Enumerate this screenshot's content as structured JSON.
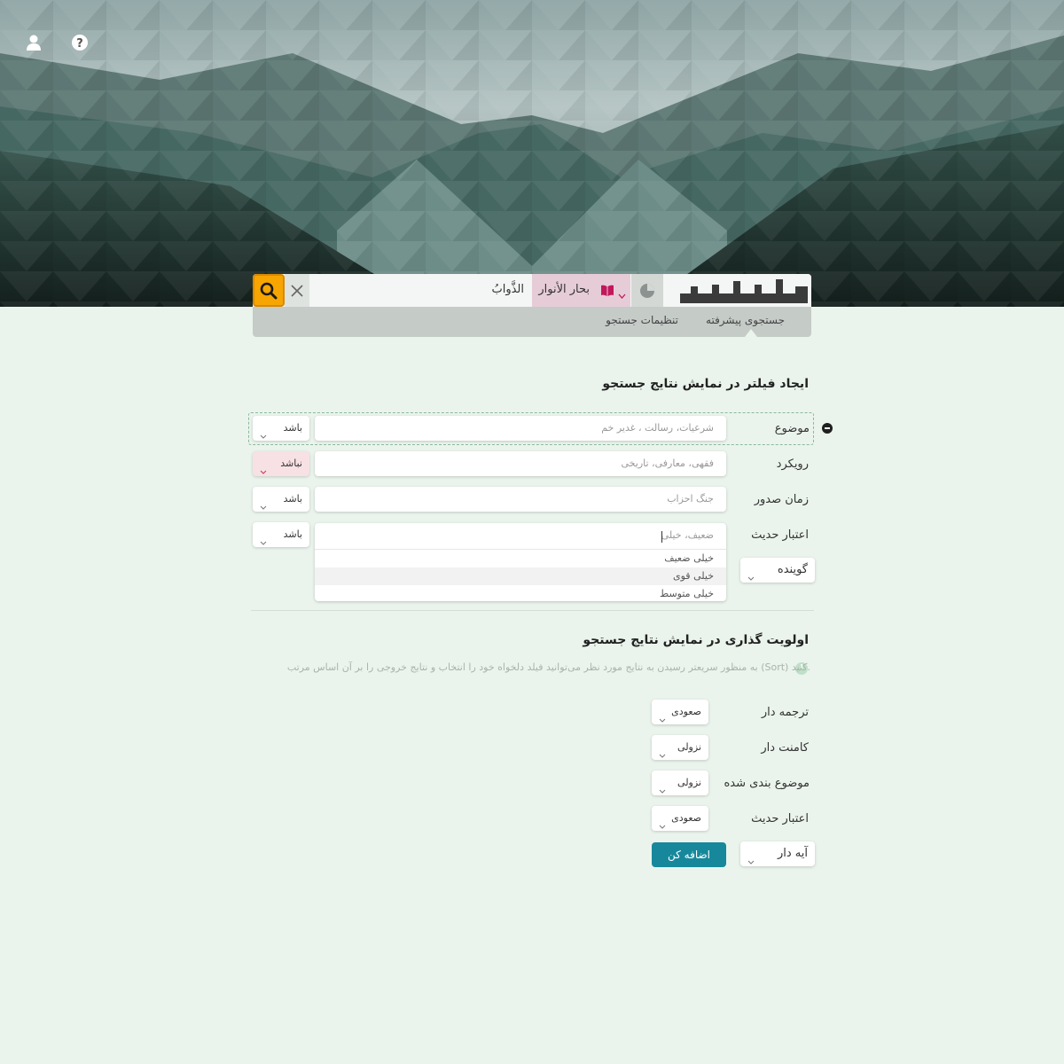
{
  "header": {
    "user_icon": "user-icon",
    "help_icon": "question-circle-icon"
  },
  "search": {
    "query": "الذَّوابُ",
    "book": "بحار الأنوار",
    "tabs": [
      "جستجوی پیشرفته",
      "تنظیمات جستجو"
    ],
    "accent_color": "#f7a500"
  },
  "filter_section": {
    "title": "ایجاد فیلتر در نمایش نتایج جستجو",
    "rows": [
      {
        "label": "موضوع",
        "placeholder": "شرعیات، رسالت ، غدیر خم",
        "condition": "باشد"
      },
      {
        "label": "رویکرد",
        "placeholder": "فقهی، معارفی، تاریخی",
        "condition": "نباشد"
      },
      {
        "label": "زمان صدور",
        "placeholder": "جنگ احزاب",
        "condition": "باشد"
      },
      {
        "label": "اعتبار حدیث",
        "placeholder": "ضعیف، خیلی",
        "condition": "باشد"
      }
    ],
    "suggestions": [
      "خیلی ضعیف",
      "خیلی قوی",
      "خیلی متوسط"
    ],
    "add_field": "گوینده"
  },
  "priority_section": {
    "title": "اولویت گذاری در نمایش نتایج جستجو",
    "info": "به منظور سریعتر رسیدن به نتایج مورد نظر می‌توانید فیلد دلخواه خود را انتخاب و نتایج خروجی را بر آن اساس مرتب (Sort) کنید.",
    "rows": [
      {
        "label": "ترجمه دار",
        "order": "صعودی"
      },
      {
        "label": "کامنت دار",
        "order": "نزولی"
      },
      {
        "label": "موضوع بندی شده",
        "order": "نزولی"
      },
      {
        "label": "اعتبار حدیث",
        "order": "صعودی"
      }
    ],
    "add_field": "آیه دار",
    "add_button": "اضافه کن",
    "button_color": "#17889b"
  }
}
